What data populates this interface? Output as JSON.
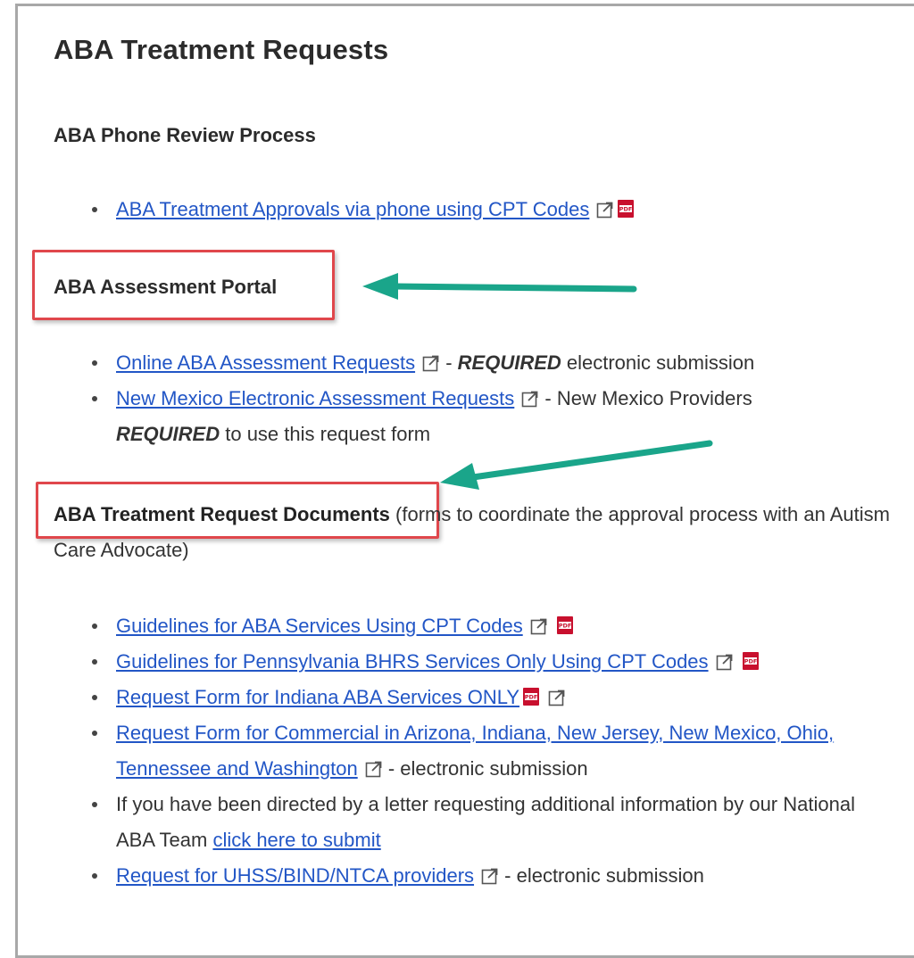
{
  "page": {
    "title": "ABA Treatment Requests"
  },
  "phone_section": {
    "heading": "ABA Phone Review Process",
    "items": [
      {
        "link": "ABA Treatment Approvals via phone using CPT Codes",
        "icons": [
          "external-link-icon",
          "pdf-icon"
        ]
      }
    ]
  },
  "portal_section": {
    "heading": "ABA Assessment Portal",
    "items": [
      {
        "link": "Online ABA Assessment Requests",
        "sep": " - ",
        "emph": "REQUIRED",
        "suffix": " electronic submission"
      },
      {
        "link": "New Mexico Electronic Assessment Requests",
        "sep": " - New Mexico Providers",
        "emph": "REQUIRED",
        "suffix": " to use this request form"
      }
    ]
  },
  "documents_section": {
    "heading": "ABA Treatment Request Documents",
    "heading_suffix": " (forms to coordinate the approval process with an Autism Care Advocate)",
    "items": [
      {
        "link": "Guidelines for ABA Services Using CPT Codes"
      },
      {
        "link": "Guidelines for Pennsylvania BHRS Services Only Using CPT Codes"
      },
      {
        "link": "Request Form for Indiana ABA Services ONLY"
      },
      {
        "link": "Request Form for Commercial in Arizona, Indiana, New Jersey, New Mexico, Ohio, Tennessee and Washington",
        "suffix": " - electronic submission"
      },
      {
        "text": "If you have been directed by a letter requesting additional information by our National ABA Team ",
        "link": "click here to submit"
      },
      {
        "link": "Request for UHSS/BIND/NTCA providers",
        "suffix": " - electronic submission"
      }
    ]
  },
  "colors": {
    "link": "#2256c6",
    "highlight_box": "#e0474c",
    "arrow": "#1aa58a",
    "frame_border": "#a8a8a8"
  }
}
